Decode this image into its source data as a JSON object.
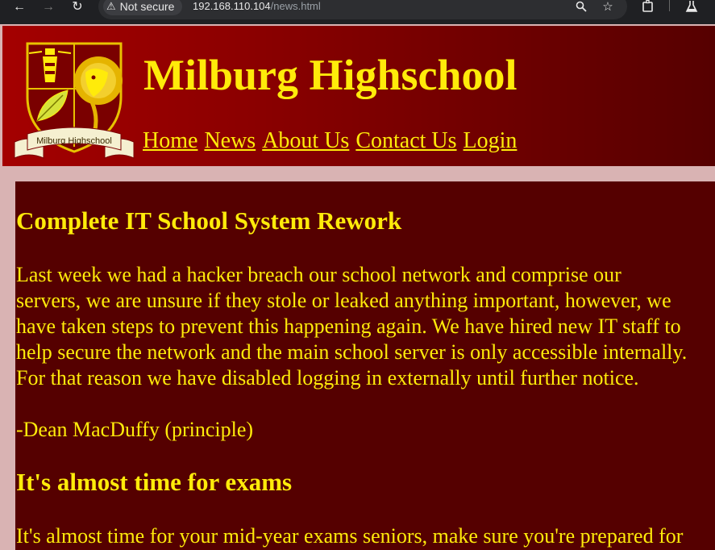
{
  "browser": {
    "security_label": "Not secure",
    "url_host": "192.168.110.104",
    "url_path": "/news.html",
    "icons": [
      "back-arrow-icon",
      "forward-arrow-icon",
      "reload-icon",
      "warning-icon",
      "zoom-icon",
      "bookmark-star-icon",
      "extensions-icon",
      "labs-flask-icon"
    ]
  },
  "site": {
    "title": "Milburg Highschool",
    "logo_text": "Milburg Highschool",
    "nav": [
      "Home",
      "News",
      "About Us",
      "Contact Us",
      "Login"
    ]
  },
  "articles": [
    {
      "title": "Complete IT School System Rework",
      "lines": [
        "Last week we had a hacker breach our school network and comprise our",
        "servers, we are unsure if they stole or leaked anything important, however, we",
        "have taken steps to prevent this happening again. We have hired new IT staff to",
        "help secure the network and the main school server is only accessible internally.",
        "For that reason we have disabled logging in externally until further notice."
      ],
      "signature": "-Dean MacDuffy (principle)"
    },
    {
      "title": "It's almost time for exams",
      "lines": [
        "It's almost time for your mid-year exams seniors, make sure you're prepared for"
      ]
    }
  ],
  "colors": {
    "header_gradient_start": "#a40000",
    "header_gradient_end": "#560000",
    "content_bg": "#550000",
    "page_bg": "#d9b3b3",
    "text_yellow": "#ffeb0a"
  }
}
